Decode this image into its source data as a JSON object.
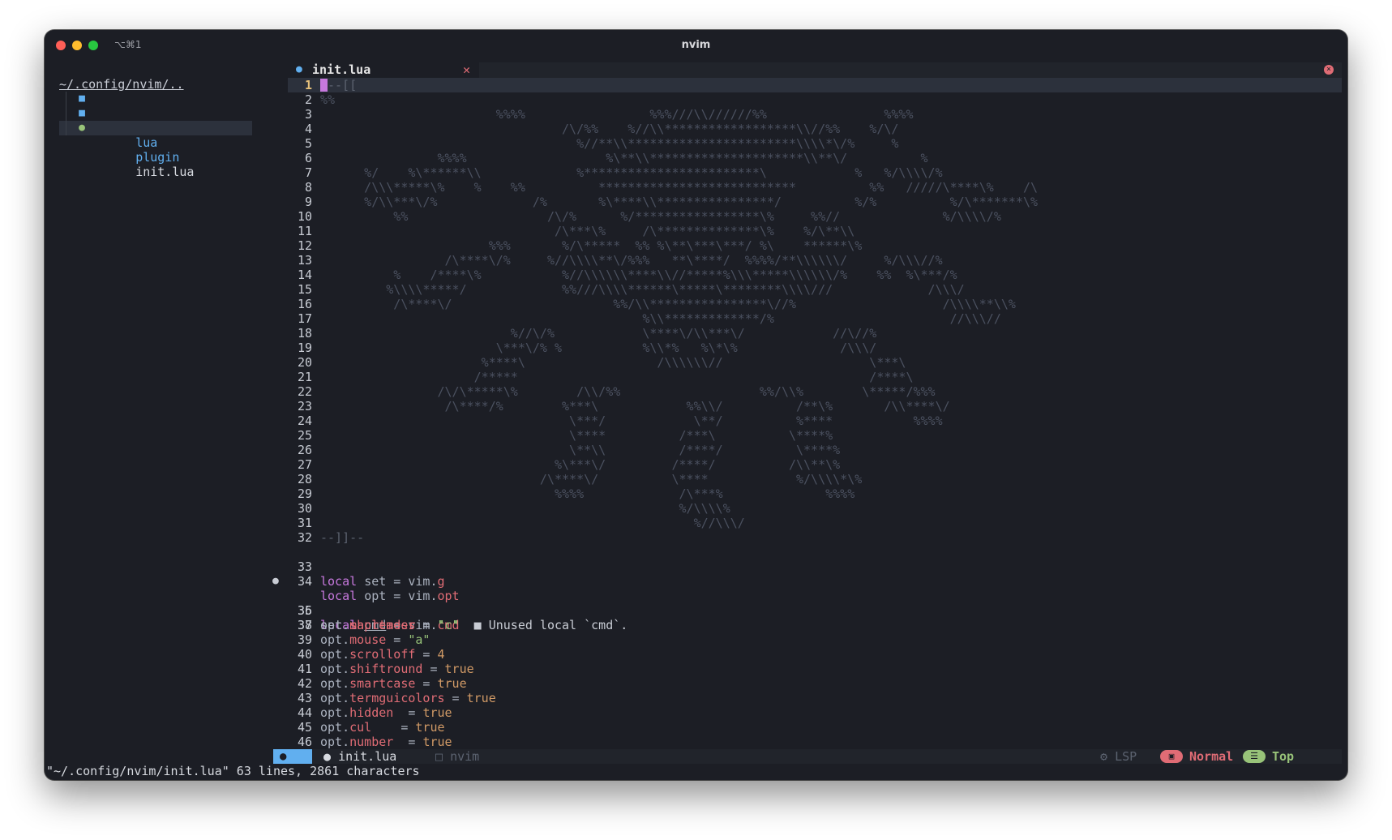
{
  "window": {
    "title": "nvim",
    "shortcut": "⌥⌘1"
  },
  "tree": {
    "root": "~/.config/nvim/..",
    "items": [
      {
        "label": "lua",
        "icon": "folder-icon"
      },
      {
        "label": "plugin",
        "icon": "folder-icon"
      },
      {
        "label": "init.lua",
        "icon": "lua-file-icon",
        "selected": true
      }
    ]
  },
  "tabbar": {
    "tab_label": "init.lua",
    "tab_close": "✕"
  },
  "editor": {
    "current_line": 1,
    "lines": [
      {
        "n": "1",
        "t": "--[["
      },
      {
        "n": "2",
        "t": "%%"
      },
      {
        "n": "3",
        "t": "                        %%%%                 %%%///\\\\//////%%                %%%%"
      },
      {
        "n": "4",
        "t": "                                 /\\/%%    %//\\\\******************\\\\//%%    %/\\/"
      },
      {
        "n": "5",
        "t": "                                   %//**\\\\***********************\\\\\\\\*\\/%     %"
      },
      {
        "n": "6",
        "t": "                %%%%                   %\\**\\\\*********************\\\\**\\/          %"
      },
      {
        "n": "7",
        "t": "      %/    %\\******\\\\             %************************\\            %   %/\\\\\\\\/%"
      },
      {
        "n": "8",
        "t": "      /\\\\\\*****\\%    %    %%          ***************************          %%   /////\\****\\%    /\\"
      },
      {
        "n": "9",
        "t": "      %/\\\\***\\/%             /%       %\\****\\\\****************/          %/%          %/\\*******\\%"
      },
      {
        "n": "10",
        "t": "          %%                   /\\/%      %/*****************\\%     %%//              %/\\\\\\\\/%"
      },
      {
        "n": "11",
        "t": "                                /\\***\\%     /\\**************\\%    %/\\**\\\\"
      },
      {
        "n": "12",
        "t": "                       %%%       %/\\*****  %% %\\**\\***\\***/ %\\    ******\\%"
      },
      {
        "n": "13",
        "t": "                 /\\****\\/%     %//\\\\\\\\**\\/%%%   **\\****/  %%%%/**\\\\\\\\\\\\/     %/\\\\\\//%"
      },
      {
        "n": "14",
        "t": "          %    /****\\%           %//\\\\\\\\\\\\****\\\\//*****%\\\\\\*****\\\\\\\\\\\\/%    %%  %\\***/%"
      },
      {
        "n": "15",
        "t": "         %\\\\\\\\*****/             %%///\\\\\\\\******\\*****\\********\\\\\\\\///             /\\\\\\/"
      },
      {
        "n": "16",
        "t": "          /\\****\\/                      %%/\\\\****************\\//%                    /\\\\\\\\**\\\\%"
      },
      {
        "n": "17",
        "t": "                                            %\\\\*************/%                        //\\\\\\//"
      },
      {
        "n": "18",
        "t": "                          %//\\/%            \\****\\/\\\\***\\/            //\\//%"
      },
      {
        "n": "19",
        "t": "                        \\***\\/% %           %\\\\*%   %\\*\\%              /\\\\\\/"
      },
      {
        "n": "20",
        "t": "                      %****\\                  /\\\\\\\\\\\\//                    \\***\\"
      },
      {
        "n": "21",
        "t": "                     /*****                                                /****\\"
      },
      {
        "n": "22",
        "t": "                /\\/\\*****\\%        /\\\\/%%                   %%/\\\\%        \\*****/%%%"
      },
      {
        "n": "23",
        "t": "                 /\\****/%        %***\\            %%\\\\/          /**\\%       /\\\\****\\/"
      },
      {
        "n": "24",
        "t": "                                  \\***/            \\**/          %****           %%%%"
      },
      {
        "n": "25",
        "t": "                                  \\****          /***\\          \\****%"
      },
      {
        "n": "26",
        "t": "                                  \\**\\\\          /****/          \\****%"
      },
      {
        "n": "27",
        "t": "                                %\\***\\/         /****/          /\\\\**\\%"
      },
      {
        "n": "28",
        "t": "                              /\\****\\/          \\****            %/\\\\\\\\*\\%"
      },
      {
        "n": "29",
        "t": "                                %%%%             /\\***%              %%%%"
      },
      {
        "n": "30",
        "t": "                                                 %/\\\\\\\\%"
      },
      {
        "n": "31",
        "t": "                                                   %//\\\\\\/"
      },
      {
        "n": "32",
        "t": "--]]--"
      }
    ],
    "code": {
      "l33": {
        "n": "33",
        "kw": "local",
        "name": "set",
        "op": " = ",
        "obj": "vim",
        "dot": ".",
        "field": "g"
      },
      "l34": {
        "n": "34",
        "kw": "local",
        "name": "opt",
        "op": " = ",
        "obj": "vim",
        "dot": ".",
        "field": "opt"
      },
      "l35": {
        "n": "35",
        "kw": "local",
        "name": "cmd",
        "op": " = ",
        "obj": "vim",
        "dot": ".",
        "field": "cmd",
        "diagnostic": "■ Unused local `cmd`."
      },
      "l36": {
        "n": "36",
        "obj": "set",
        "dot": ".",
        "field": "mapleader",
        "op": " = ",
        "val": "\" \""
      },
      "l37": {
        "n": "37"
      },
      "opts": [
        {
          "n": "38",
          "field": "shortmess",
          "op": " = ",
          "val": "'c'",
          "vtype": "str"
        },
        {
          "n": "39",
          "field": "mouse",
          "op": " = ",
          "val": "\"a\"",
          "vtype": "str"
        },
        {
          "n": "40",
          "field": "scrolloff",
          "op": " = ",
          "val": "4",
          "vtype": "num"
        },
        {
          "n": "41",
          "field": "shiftround",
          "op": " = ",
          "val": "true",
          "vtype": "bool"
        },
        {
          "n": "42",
          "field": "smartcase",
          "op": " = ",
          "val": "true",
          "vtype": "bool"
        },
        {
          "n": "43",
          "field": "termguicolors",
          "op": " = ",
          "val": "true",
          "vtype": "bool"
        },
        {
          "n": "44",
          "field": "hidden",
          "op": "  = ",
          "val": "true",
          "vtype": "bool"
        },
        {
          "n": "45",
          "field": "cul",
          "op": "    = ",
          "val": "true",
          "vtype": "bool"
        },
        {
          "n": "46",
          "field": "number",
          "op": "  = ",
          "val": "true",
          "vtype": "bool"
        }
      ],
      "opt_obj": "opt",
      "dot": "."
    }
  },
  "statusline": {
    "file": "init.lua",
    "project": "nvim",
    "lsp": "LSP",
    "mode": "Normal",
    "position": "Top"
  },
  "cmdline": "\"~/.config/nvim/init.lua\" 63 lines, 2861 characters",
  "colors": {
    "background": "#1c1e25",
    "keyword": "#c678dd",
    "field": "#e06c75",
    "string": "#98c379",
    "number": "#d19a66",
    "accent": "#61afef"
  }
}
